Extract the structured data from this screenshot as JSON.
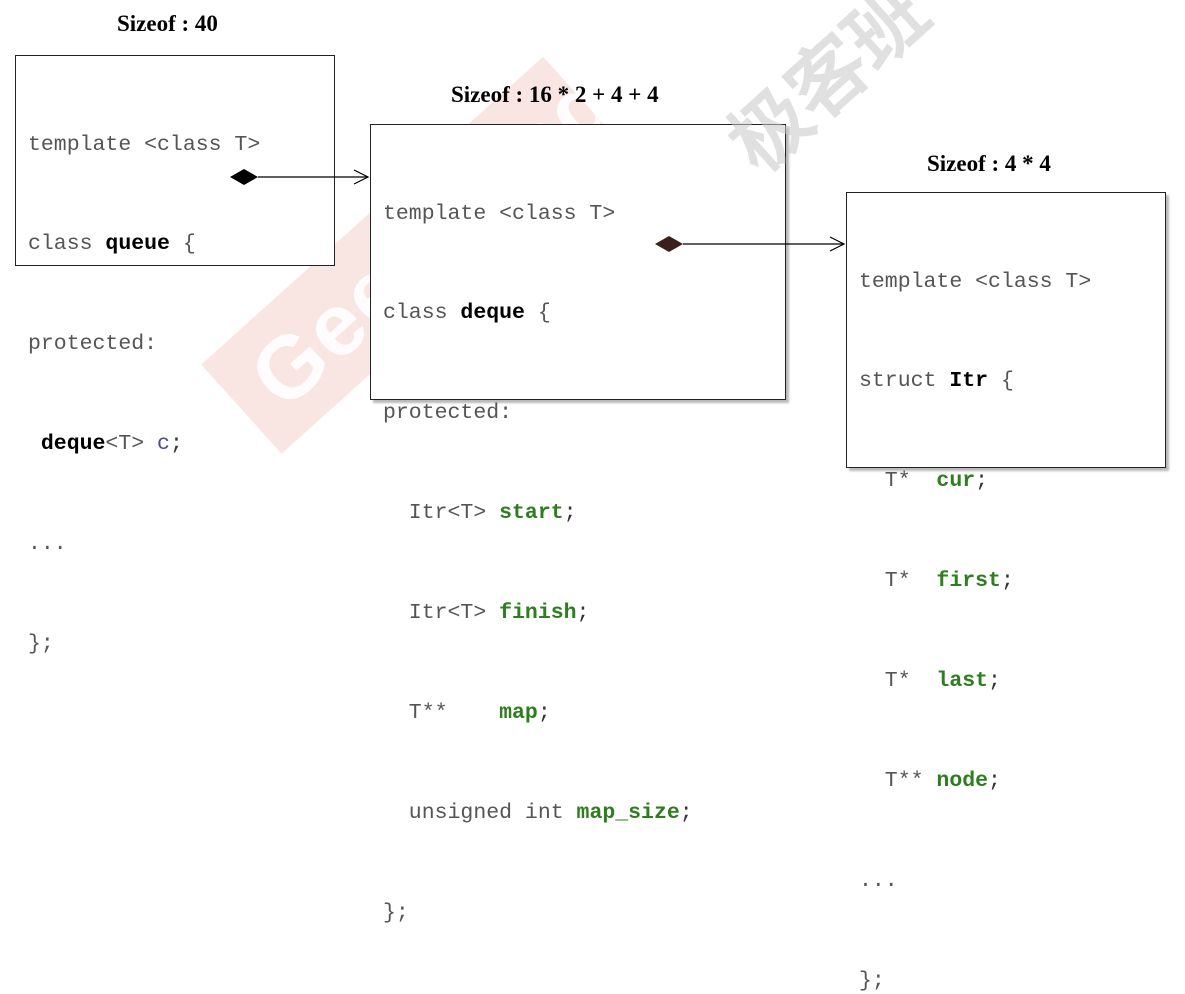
{
  "titles": {
    "queue_size": "Sizeof : 40",
    "deque_size": "Sizeof : 16 * 2 + 4 + 4",
    "itr_size": "Sizeof : 4 * 4"
  },
  "queue_box": {
    "line1": "template <class T>",
    "line2_kw": "class ",
    "line2_name": "queue",
    "line2_brace": " {",
    "line3": "protected:",
    "line4_type": "deque",
    "line4_tmpl": "<T> ",
    "line4_var": "c",
    "line4_semi": ";",
    "line5": "...",
    "line6": "};"
  },
  "deque_box": {
    "line1": "template <class T>",
    "line2_kw": "class ",
    "line2_name": "deque",
    "line2_brace": " {",
    "line3": "protected:",
    "m1_type": "  Itr<T> ",
    "m1_name": "start",
    "m2_type": "  Itr<T> ",
    "m2_name": "finish",
    "m3_type": "  T**    ",
    "m3_name": "map",
    "m4_type": "  unsigned int ",
    "m4_name": "map_size",
    "semi": ";",
    "line_end": "};"
  },
  "itr_box": {
    "line1": "template <class T>",
    "line2_kw": "struct ",
    "line2_name": "Itr",
    "line2_brace": " {",
    "f1_type": "  T*  ",
    "f1_name": "cur",
    "f2_type": "  T*  ",
    "f2_name": "first",
    "f3_type": "  T*  ",
    "f3_name": "last",
    "f4_type": "  T** ",
    "f4_name": "node",
    "semi": ";",
    "line_dots": "...",
    "line_end": "};"
  },
  "watermark": {
    "text": "GeekBand",
    "chinese": "极客班"
  },
  "colors": {
    "member_green": "#2e7d1e",
    "watermark_red": "#e06a5a",
    "watermark_gray": "#c8c8c8"
  }
}
